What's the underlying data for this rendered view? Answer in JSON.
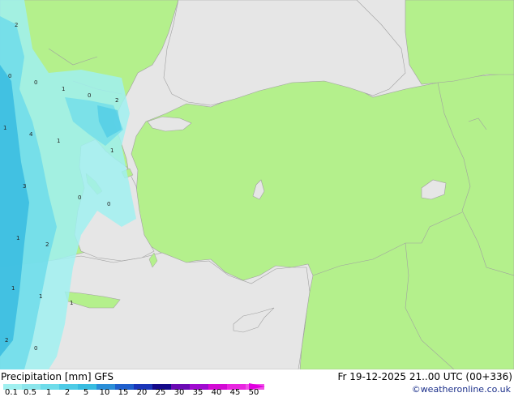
{
  "footer": {
    "title": "Precipitation [mm] GFS",
    "run": "Fr 19-12-2025 21..00 UTC (00+336)",
    "credit": "©weatheronline.co.uk"
  },
  "legend": {
    "ticks": [
      "0.1",
      "0.5",
      "1",
      "2",
      "5",
      "10",
      "15",
      "20",
      "25",
      "30",
      "35",
      "40",
      "45",
      "50"
    ],
    "colors": [
      "#a0f0f0",
      "#8ce6ec",
      "#6edcea",
      "#4dcbe6",
      "#38bce0",
      "#2a8ed8",
      "#1f5fcc",
      "#1a35b8",
      "#150a8a",
      "#6a0ab4",
      "#a00ad0",
      "#d20ad4",
      "#e826e0",
      "#f050e8"
    ],
    "arrow_color": "#e000e0"
  },
  "map": {
    "colors": {
      "land": "#b4f08c",
      "sea": "#e6e6e6",
      "border": "#a0a0a0"
    },
    "contour_labels": [
      "2",
      "0",
      "0",
      "1",
      "0",
      "2",
      "1",
      "4",
      "1",
      "1",
      "3",
      "0",
      "0",
      "1",
      "2",
      "1",
      "1",
      "1",
      "2",
      "0"
    ]
  }
}
